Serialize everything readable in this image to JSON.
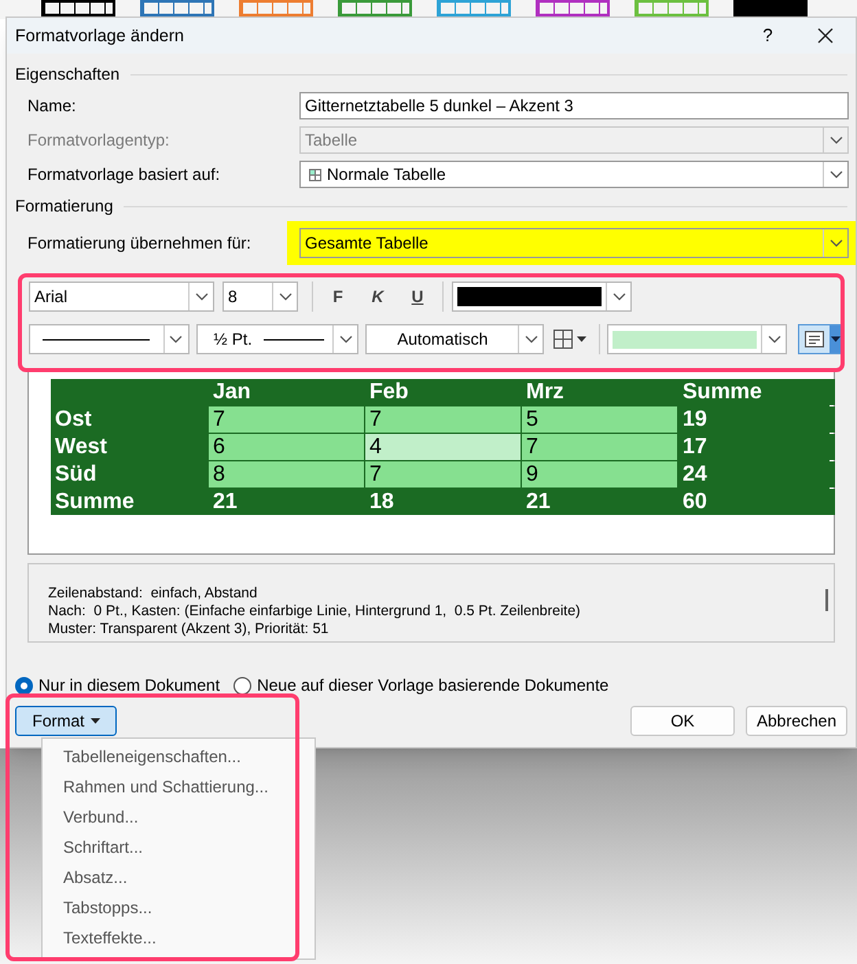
{
  "style_gallery": [
    {
      "color": "#000000",
      "kind": "outline"
    },
    {
      "color": "#2e75b6",
      "kind": "outline"
    },
    {
      "color": "#ed7d31",
      "kind": "outline"
    },
    {
      "color": "#3a9a3a",
      "kind": "outline"
    },
    {
      "color": "#2ea3d6",
      "kind": "outline"
    },
    {
      "color": "#b030c0",
      "kind": "outline"
    },
    {
      "color": "#6cc040",
      "kind": "outline"
    },
    {
      "color": "#000000",
      "kind": "solid"
    }
  ],
  "window": {
    "title": "Formatvorlage ändern",
    "help_button": "?"
  },
  "properties": {
    "heading": "Eigenschaften",
    "fields": [
      {
        "label": "Name:",
        "value": "Gitternetztabelle 5 dunkel  – Akzent 3",
        "kind": "text",
        "disabled": false
      },
      {
        "label": "Formatvorlagentyp:",
        "value": "Tabelle",
        "kind": "dropdown",
        "disabled": true
      },
      {
        "label": "Formatvorlage basiert auf:",
        "value": "Normale Tabelle",
        "kind": "table_dropdown",
        "disabled": false
      }
    ]
  },
  "formatting": {
    "heading": "Formatierung",
    "apply_to": {
      "label": "Formatierung übernehmen für:",
      "value": "Gesamte Tabelle",
      "highlighted": true
    },
    "toolbar": {
      "framed": true,
      "font": "Arial",
      "size": "8",
      "bold_button": "F",
      "italic_button": "K",
      "underline_button": "U",
      "line_weight": "½ Pt.",
      "border_color": "Automatisch"
    }
  },
  "preview_table": {
    "columns": [
      "Jan",
      "Feb",
      "Mrz",
      "Summe"
    ],
    "rows": [
      {
        "label": "Ost",
        "cells": [
          {
            "text": "7",
            "color": "#86e090"
          },
          {
            "text": "7",
            "color": "#86e090"
          },
          {
            "text": "5",
            "color": "#86e090"
          }
        ],
        "total": "19"
      },
      {
        "label": "West",
        "cells": [
          {
            "text": "6",
            "color": "#86e090"
          },
          {
            "text": "4",
            "color": "#c1efc9"
          },
          {
            "text": "7",
            "color": "#86e090"
          }
        ],
        "total": "17"
      },
      {
        "label": "Süd",
        "cells": [
          {
            "text": "8",
            "color": "#86e090"
          },
          {
            "text": "7",
            "color": "#86e090"
          },
          {
            "text": "9",
            "color": "#86e090"
          }
        ],
        "total": "24"
      }
    ],
    "total_row": {
      "label": "Summe",
      "values": [
        "21",
        "18",
        "21",
        "60"
      ]
    }
  },
  "description": [
    "Zeilenabstand:  einfach, Abstand",
    "Nach:  0 Pt., Kasten: (Einfache einfarbige Linie, Hintergrund 1,  0.5 Pt. Zeilenbreite)",
    "Muster: Transparent (Akzent 3), Priorität: 51"
  ],
  "scope": [
    {
      "label": "Nur in diesem Dokument",
      "selected": true
    },
    {
      "label": "Neue auf dieser Vorlage basierende Dokumente",
      "selected": false
    }
  ],
  "buttons": {
    "format": "Format",
    "ok": "OK",
    "cancel": "Abbrechen"
  },
  "format_menu": {
    "framed": true,
    "items": [
      "Tabelleneigenschaften...",
      "Rahmen und Schattierung...",
      "Verbund...",
      "Schriftart...",
      "Absatz...",
      "Tabstopps...",
      "Texteffekte..."
    ]
  }
}
